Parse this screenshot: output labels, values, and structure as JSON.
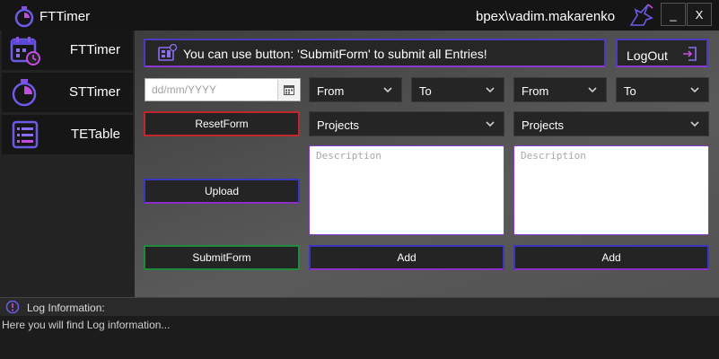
{
  "titlebar": {
    "title": "FTTimer",
    "user": "bpex\\vadim.makarenko",
    "minimize_label": "_",
    "close_label": "X"
  },
  "sidebar": {
    "items": [
      {
        "label": "FTTimer",
        "icon": "calendar-clock-icon"
      },
      {
        "label": "STTimer",
        "icon": "stopwatch-icon"
      },
      {
        "label": "TETable",
        "icon": "table-list-icon"
      }
    ]
  },
  "banner": {
    "text": "You can use button: 'SubmitForm' to submit all Entries!",
    "icon": "info-panel-icon"
  },
  "logout": {
    "label": "LogOut",
    "icon": "logout-icon"
  },
  "date": {
    "placeholder": "dd/mm/YYYY",
    "icon": "calendar-icon"
  },
  "entries": [
    {
      "from": "From",
      "to": "To",
      "project": "Projects",
      "description_placeholder": "Description",
      "add_label": "Add"
    },
    {
      "from": "From",
      "to": "To",
      "project": "Projects",
      "description_placeholder": "Description",
      "add_label": "Add"
    }
  ],
  "buttons": {
    "reset": "ResetForm",
    "upload": "Upload",
    "submit": "SubmitForm"
  },
  "log": {
    "title": "Log Information:",
    "text": "Here you will find Log information..."
  },
  "colors": {
    "accent_blue": "#3a36c0",
    "accent_purple": "#8a2fc8",
    "reset_red": "#c0262b",
    "submit_green": "#1f8a3e"
  }
}
